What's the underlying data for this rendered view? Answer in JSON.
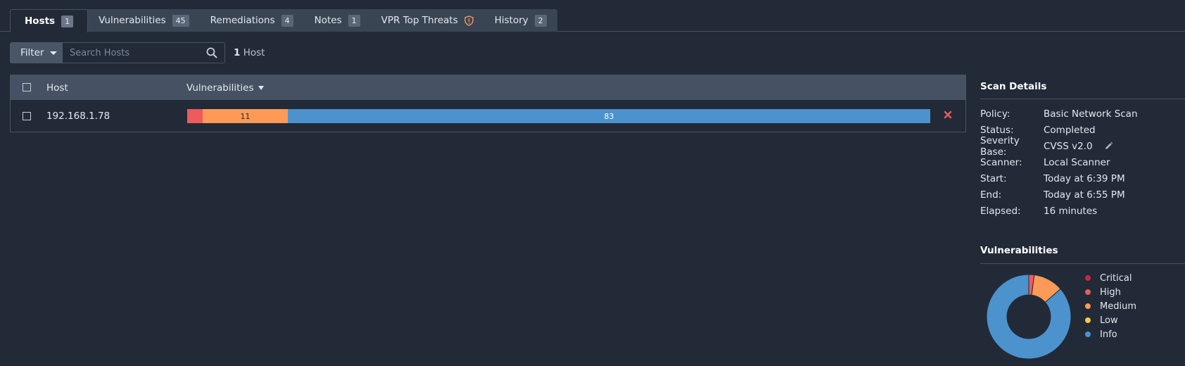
{
  "tabs": [
    {
      "label": "Hosts",
      "count": "1"
    },
    {
      "label": "Vulnerabilities",
      "count": "45"
    },
    {
      "label": "Remediations",
      "count": "4"
    },
    {
      "label": "Notes",
      "count": "1"
    },
    {
      "label": "VPR Top Threats",
      "icon": "shield-icon"
    },
    {
      "label": "History",
      "count": "2"
    }
  ],
  "filter": {
    "label": "Filter",
    "placeholder": "Search Hosts"
  },
  "host_count": {
    "number": "1",
    "unit": "Host"
  },
  "table": {
    "columns": {
      "host": "Host",
      "vulnerabilities": "Vulnerabilities"
    },
    "rows": [
      {
        "host": "192.168.1.78",
        "segments": [
          {
            "severity": "critical",
            "value": 0,
            "label": ""
          },
          {
            "severity": "high",
            "value": 2,
            "label": ""
          },
          {
            "severity": "medium",
            "value": 11,
            "label": "11"
          },
          {
            "severity": "low",
            "value": 0,
            "label": ""
          },
          {
            "severity": "info",
            "value": 83,
            "label": "83"
          }
        ]
      }
    ]
  },
  "scan_details": {
    "title": "Scan Details",
    "rows": [
      {
        "key": "Policy:",
        "value": "Basic Network Scan"
      },
      {
        "key": "Status:",
        "value": "Completed"
      },
      {
        "key": "Severity Base:",
        "value": "CVSS v2.0"
      },
      {
        "key": "Scanner:",
        "value": "Local Scanner"
      },
      {
        "key": "Start:",
        "value": "Today at 6:39 PM"
      },
      {
        "key": "End:",
        "value": "Today at 6:55 PM"
      },
      {
        "key": "Elapsed:",
        "value": "16 minutes"
      }
    ]
  },
  "vuln_chart": {
    "title": "Vulnerabilities",
    "legend": [
      "Critical",
      "High",
      "Medium",
      "Low",
      "Info"
    ]
  },
  "colors": {
    "critical": "#c8283f",
    "high": "#ee5b5c",
    "medium": "#fd9a57",
    "low": "#fdc845",
    "info": "#4c92cd"
  },
  "chart_data": {
    "type": "pie",
    "categories": [
      "Critical",
      "High",
      "Medium",
      "Low",
      "Info"
    ],
    "values": [
      0,
      2,
      11,
      0,
      83
    ],
    "title": "Vulnerabilities",
    "donut": true,
    "legend_position": "right"
  }
}
